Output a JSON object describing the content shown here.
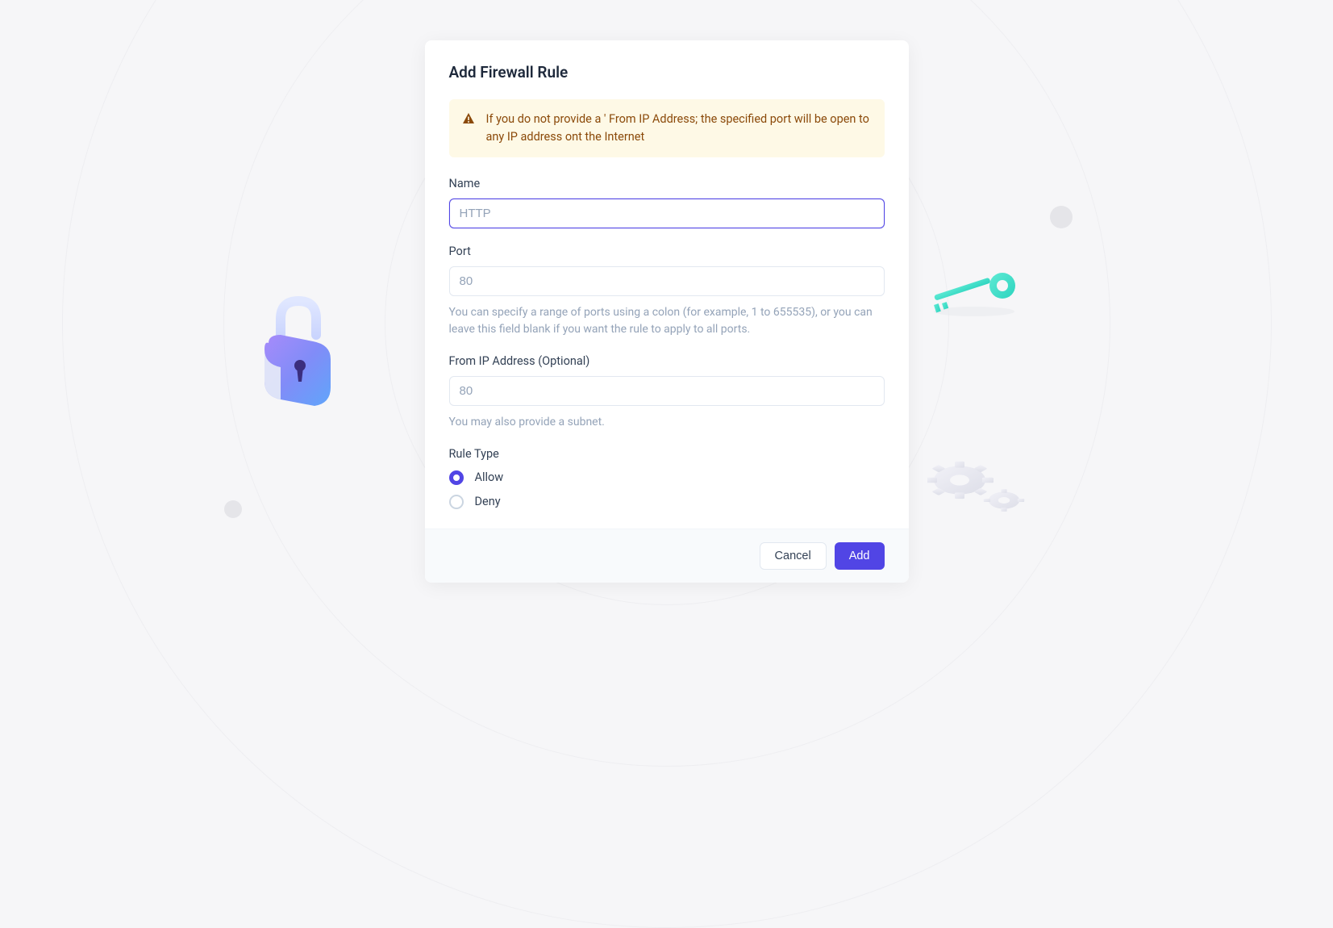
{
  "modal": {
    "title": "Add Firewall Rule",
    "alert": "If you do not provide a ' From IP Address; the specified port will be open to any IP address ont the Internet",
    "name": {
      "label": "Name",
      "placeholder": "HTTP",
      "value": ""
    },
    "port": {
      "label": "Port",
      "placeholder": "80",
      "value": "",
      "help": "You can specify a range of ports using a colon (for example, 1 to 655535), or you can leave this field blank if you want the rule to apply to all ports."
    },
    "fromIp": {
      "label": "From IP Address (Optional)",
      "placeholder": "80",
      "value": "",
      "help": "You may also provide a subnet."
    },
    "ruleType": {
      "label": "Rule Type",
      "options": {
        "allow": "Allow",
        "deny": "Deny"
      },
      "selected": "allow"
    },
    "buttons": {
      "cancel": "Cancel",
      "add": "Add"
    }
  },
  "colors": {
    "primary": "#5145e5",
    "alertBg": "#fef9e6",
    "alertText": "#8b4a0a"
  }
}
